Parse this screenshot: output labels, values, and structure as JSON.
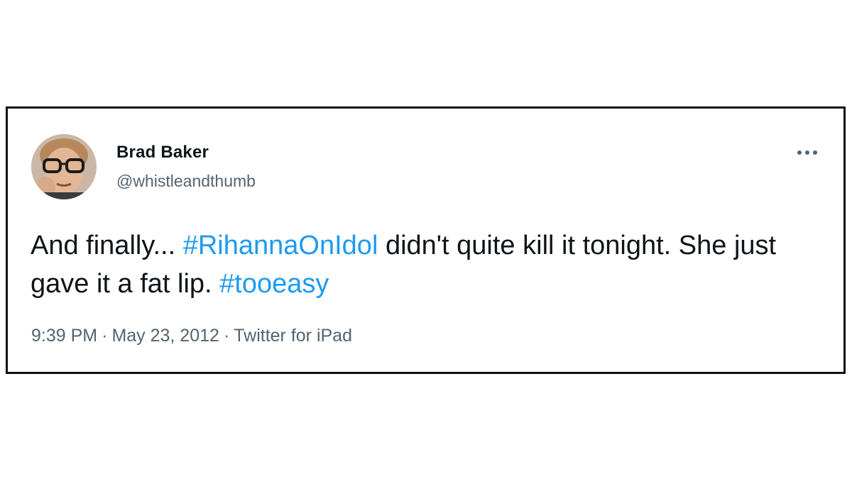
{
  "tweet": {
    "display_name": "Brad Baker",
    "handle": "@whistleandthumb",
    "avatar_icon": "user-photo-avatar",
    "more_icon": "more-horizontal-icon",
    "text_parts": {
      "p1": "And finally... ",
      "hashtag1": "#RihannaOnIdol",
      "p2": " didn't quite kill it tonight. She just gave it a fat lip. ",
      "hashtag2": "#tooeasy"
    },
    "time": "9:39 PM",
    "date": "May 23, 2012",
    "source": "Twitter for iPad",
    "separator": "·"
  },
  "colors": {
    "hashtag": "#1d9bf0",
    "text": "#0f1419",
    "secondary": "#536471",
    "border": "#111111"
  }
}
